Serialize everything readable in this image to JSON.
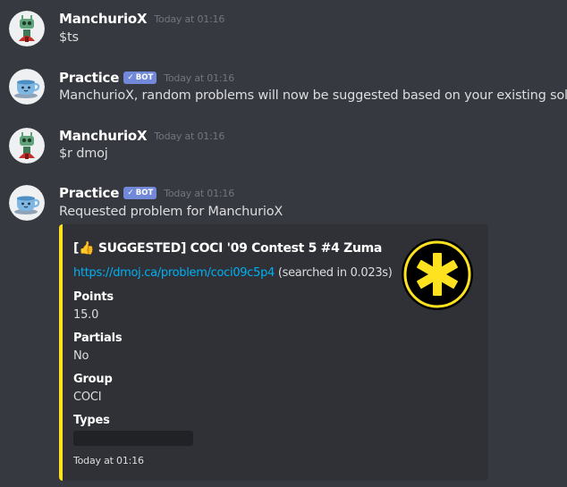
{
  "messages": [
    {
      "username": "ManchurioX",
      "avatar": "robot-avatar",
      "timestamp": "Today at 01:16",
      "text": "$ts"
    },
    {
      "username": "Practice",
      "bot_label": "BOT",
      "avatar": "teacup-avatar",
      "timestamp": "Today at 01:16",
      "text": "ManchurioX, random problems will now be suggested based on your existing solves"
    },
    {
      "username": "ManchurioX",
      "avatar": "robot-avatar",
      "timestamp": "Today at 01:16",
      "text": "$r dmoj"
    },
    {
      "username": "Practice",
      "bot_label": "BOT",
      "avatar": "teacup-avatar",
      "timestamp": "Today at 01:16",
      "text": "Requested problem for ManchurioX"
    }
  ],
  "embed": {
    "accent_color": "#fee21f",
    "title_prefix": "[",
    "title_emoji": "👍",
    "title_rest": " SUGGESTED] COCI '09 Contest 5 #4 Zuma",
    "link_text": "https://dmoj.ca/problem/coci09c5p4",
    "link_suffix": " (searched in 0.023s)",
    "fields": [
      {
        "name": "Points",
        "value": "15.0"
      },
      {
        "name": "Partials",
        "value": "No"
      },
      {
        "name": "Group",
        "value": "COCI"
      },
      {
        "name": "Types",
        "value": ""
      }
    ],
    "footer": "Today at 01:16",
    "thumbnail": "dmoj-asterisk-logo"
  },
  "colors": {
    "background": "#36393f",
    "embed_background": "#2f3136",
    "bot_tag": "#7289da",
    "link": "#00b0f4"
  }
}
